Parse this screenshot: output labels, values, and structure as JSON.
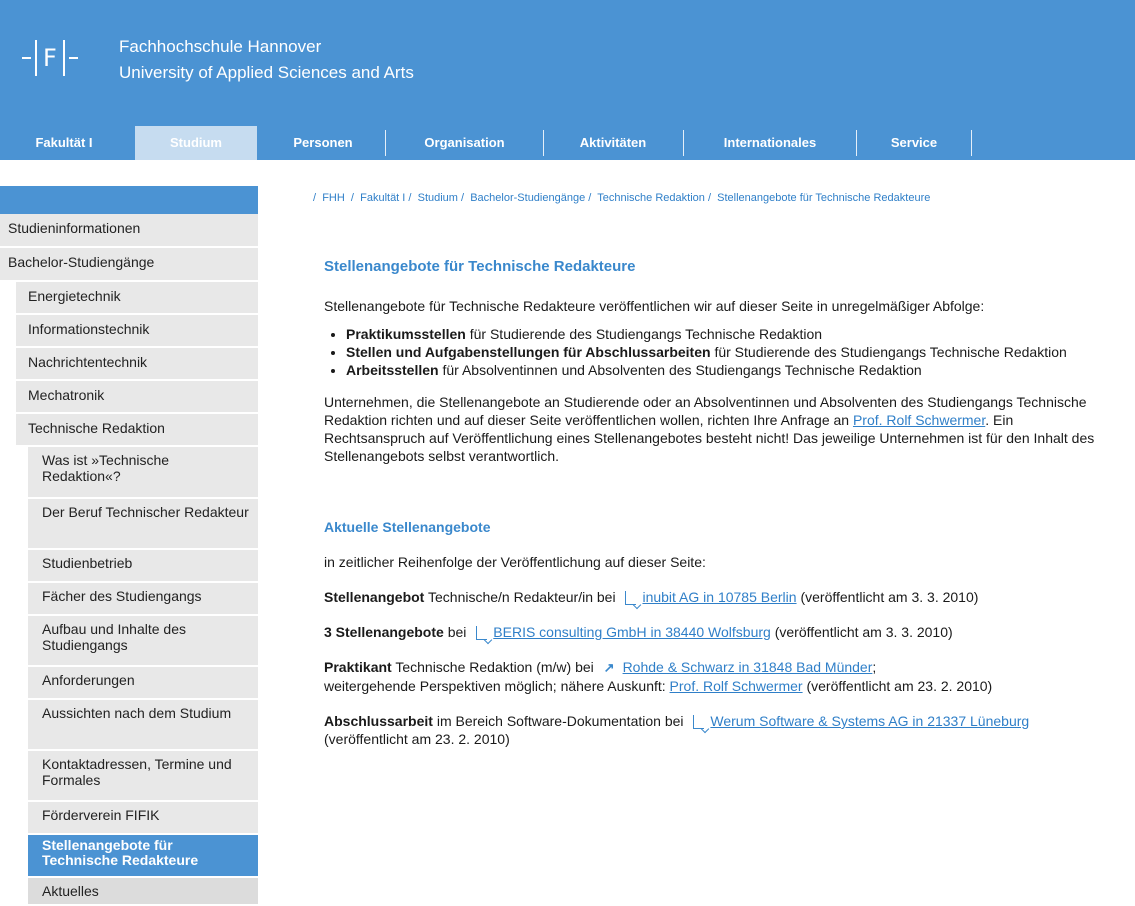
{
  "header": {
    "logo_text": "F",
    "university_line1": "Fachhochschule Hannover",
    "university_line2": "University of Applied Sciences and Arts"
  },
  "mainnav": {
    "tabs": [
      {
        "label": "Fakultät I",
        "active": false
      },
      {
        "label": "Studium",
        "active": true
      },
      {
        "label": "Personen",
        "active": false
      },
      {
        "label": "Organisation",
        "active": false
      },
      {
        "label": "Aktivitäten",
        "active": false
      },
      {
        "label": "Internationales",
        "active": false
      },
      {
        "label": "Service",
        "active": false
      }
    ]
  },
  "sidebar": {
    "items": [
      {
        "label": "Studieninformationen"
      },
      {
        "label": "Bachelor-Studiengänge"
      },
      {
        "label": "Energietechnik"
      },
      {
        "label": "Informationstechnik"
      },
      {
        "label": "Nachrichtentechnik"
      },
      {
        "label": "Mechatronik"
      },
      {
        "label": "Technische Redaktion"
      },
      {
        "label": "Was ist »Technische Redaktion«?"
      },
      {
        "label": "Der Beruf Technischer Redakteur"
      },
      {
        "label": "Studienbetrieb"
      },
      {
        "label": "Fächer des Studiengangs"
      },
      {
        "label": "Aufbau und Inhalte des Studiengangs"
      },
      {
        "label": "Anforderungen"
      },
      {
        "label": "Aussichten nach dem Studium"
      },
      {
        "label": "Kontaktadressen, Termine und Formales"
      },
      {
        "label": "Förderverein FIFIK"
      },
      {
        "label": "Stellenangebote für Technische Redakteure",
        "active": true
      },
      {
        "label": "Aktuelles"
      }
    ]
  },
  "breadcrumb": {
    "separator": "/",
    "items": [
      "FHH",
      "Fakultät I",
      "Studium",
      "Bachelor-Studiengänge",
      "Technische Redaktion",
      "Stellenangebote für Technische Redakteure"
    ]
  },
  "content": {
    "title": "Stellenangebote für Technische Redakteure",
    "intro": "Stellenangebote für Technische Redakteure veröffentlichen wir auf dieser Seite in unregelmäßiger Abfolge:",
    "bullets": [
      {
        "bold": "Praktikumsstellen",
        "rest": " für Studierende des Studiengangs Technische Redaktion"
      },
      {
        "bold": "Stellen und Aufgabenstellungen für Abschlussarbeiten",
        "rest": " für Studierende des Studiengangs Technische Redaktion"
      },
      {
        "bold": "Arbeitsstellen",
        "rest": " für Absolventinnen und Absolventen des Studiengangs Technische Redaktion"
      }
    ],
    "notice_pre": "Unternehmen, die Stellenangebote an Studierende oder an Absolventinnen und Absolventen des Studiengangs Technische Redaktion richten und auf dieser Seite veröffentlichen wollen, richten Ihre Anfrage an ",
    "notice_link": "Prof. Rolf Schwermer",
    "notice_post": ". Ein Rechtsanspruch auf Veröffentlichung eines Stellenangebotes besteht nicht! Das jeweilige Unternehmen ist für den Inhalt des Stellenangebots selbst verantwortlich.",
    "current_title": "Aktuelle Stellenangebote",
    "current_intro": "in zeitlicher Reihenfolge der Veröffentlichung auf dieser Seite:",
    "offers": [
      {
        "bold": "Stellenangebot",
        "text": " Technische/n Redakteur/in bei ",
        "icon": "document-icon",
        "link": "inubit AG in 10785 Berlin",
        "after": " (veröffentlicht am 3. 3. 2010)"
      },
      {
        "bold": "3 Stellenangebote",
        "text": " bei ",
        "icon": "document-icon",
        "link": "BERIS consulting GmbH in 38440 Wolfsburg",
        "after": " (veröffentlicht am 3. 3. 2010)"
      },
      {
        "bold": "Praktikant",
        "text": " Technische Redaktion (m/w) bei ",
        "icon": "external-link-icon",
        "link": "Rohde & Schwarz in 31848 Bad Münder",
        "after": ";",
        "extra_text": "weitergehende Perspektiven möglich; nähere Auskunft: ",
        "extra_link": "Prof. Rolf Schwermer",
        "extra_after": " (veröffentlicht am 23. 2. 2010)"
      },
      {
        "bold": "Abschlussarbeit",
        "text": " im Bereich Software-Dokumentation bei ",
        "icon": "document-icon",
        "link": "Werum Software & Systems AG in 21337 Lüneburg",
        "after": " (veröffentlicht am 23. 2. 2010)"
      }
    ]
  },
  "colors": {
    "brand_blue": "#4b93d3",
    "active_tab": "#c6dcf0",
    "link": "#2f7fc8",
    "sidebar_bg": "#e8e8e8"
  }
}
